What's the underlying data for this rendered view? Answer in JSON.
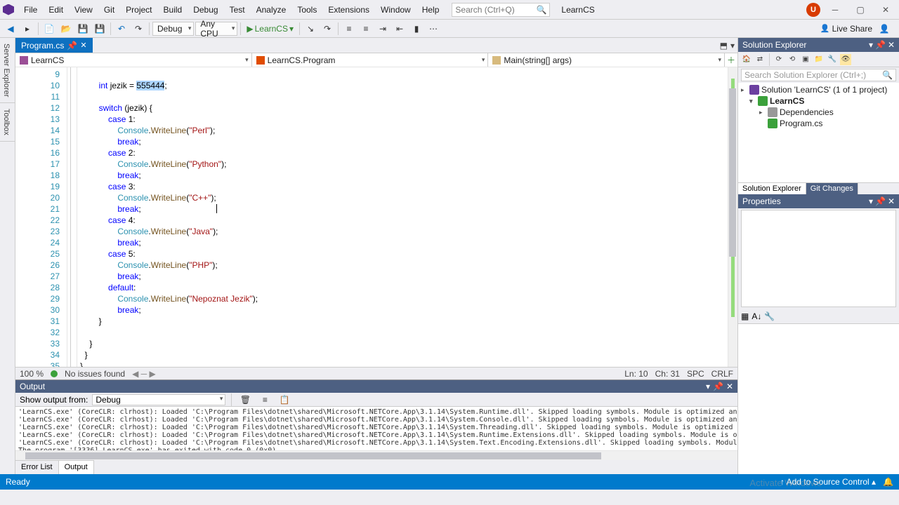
{
  "menubar": [
    "File",
    "Edit",
    "View",
    "Git",
    "Project",
    "Build",
    "Debug",
    "Test",
    "Analyze",
    "Tools",
    "Extensions",
    "Window",
    "Help"
  ],
  "search_placeholder": "Search (Ctrl+Q)",
  "title": "LearnCS",
  "user_initial": "U",
  "toolbar": {
    "config": "Debug",
    "platform": "Any CPU",
    "run_target": "LearnCS",
    "live_share": "Live Share"
  },
  "side_tabs": [
    "Server Explorer",
    "Toolbox"
  ],
  "doc_tab": "Program.cs",
  "nav": {
    "project": "LearnCS",
    "class": "LearnCS.Program",
    "member": "Main(string[] args)"
  },
  "code_lines": [
    {
      "n": 9,
      "indent": 8,
      "tokens": []
    },
    {
      "n": 10,
      "indent": 8,
      "tokens": [
        {
          "t": "int ",
          "c": "kw"
        },
        {
          "t": "jezik = "
        },
        {
          "t": "555444",
          "c": "num",
          "sel": true
        },
        {
          "t": ";"
        }
      ]
    },
    {
      "n": 11,
      "indent": 8,
      "tokens": []
    },
    {
      "n": 12,
      "indent": 8,
      "tokens": [
        {
          "t": "switch ",
          "c": "kw"
        },
        {
          "t": "(jezik) {"
        }
      ]
    },
    {
      "n": 13,
      "indent": 12,
      "tokens": [
        {
          "t": "case ",
          "c": "kw"
        },
        {
          "t": "1"
        },
        {
          "t": ":"
        }
      ]
    },
    {
      "n": 14,
      "indent": 16,
      "tokens": [
        {
          "t": "Console",
          "c": "cls"
        },
        {
          "t": "."
        },
        {
          "t": "WriteLine",
          "c": "mth"
        },
        {
          "t": "("
        },
        {
          "t": "\"Perl\"",
          "c": "str"
        },
        {
          "t": ");"
        }
      ]
    },
    {
      "n": 15,
      "indent": 16,
      "tokens": [
        {
          "t": "break",
          "c": "kw"
        },
        {
          "t": ";"
        }
      ]
    },
    {
      "n": 16,
      "indent": 12,
      "tokens": [
        {
          "t": "case ",
          "c": "kw"
        },
        {
          "t": "2"
        },
        {
          "t": ":"
        }
      ]
    },
    {
      "n": 17,
      "indent": 16,
      "tokens": [
        {
          "t": "Console",
          "c": "cls"
        },
        {
          "t": "."
        },
        {
          "t": "WriteLine",
          "c": "mth"
        },
        {
          "t": "("
        },
        {
          "t": "\"Python\"",
          "c": "str"
        },
        {
          "t": ");"
        }
      ]
    },
    {
      "n": 18,
      "indent": 16,
      "tokens": [
        {
          "t": "break",
          "c": "kw"
        },
        {
          "t": ";"
        }
      ]
    },
    {
      "n": 19,
      "indent": 12,
      "tokens": [
        {
          "t": "case ",
          "c": "kw"
        },
        {
          "t": "3"
        },
        {
          "t": ":"
        }
      ]
    },
    {
      "n": 20,
      "indent": 16,
      "tokens": [
        {
          "t": "Console",
          "c": "cls"
        },
        {
          "t": "."
        },
        {
          "t": "WriteLine",
          "c": "mth"
        },
        {
          "t": "("
        },
        {
          "t": "\"C++\"",
          "c": "str"
        },
        {
          "t": ");"
        }
      ]
    },
    {
      "n": 21,
      "indent": 16,
      "tokens": [
        {
          "t": "break",
          "c": "kw"
        },
        {
          "t": ";"
        }
      ]
    },
    {
      "n": 22,
      "indent": 12,
      "tokens": [
        {
          "t": "case ",
          "c": "kw"
        },
        {
          "t": "4"
        },
        {
          "t": ":"
        }
      ]
    },
    {
      "n": 23,
      "indent": 16,
      "tokens": [
        {
          "t": "Console",
          "c": "cls"
        },
        {
          "t": "."
        },
        {
          "t": "WriteLine",
          "c": "mth"
        },
        {
          "t": "("
        },
        {
          "t": "\"Java\"",
          "c": "str"
        },
        {
          "t": ");"
        }
      ]
    },
    {
      "n": 24,
      "indent": 16,
      "tokens": [
        {
          "t": "break",
          "c": "kw"
        },
        {
          "t": ";"
        }
      ]
    },
    {
      "n": 25,
      "indent": 12,
      "tokens": [
        {
          "t": "case ",
          "c": "kw"
        },
        {
          "t": "5"
        },
        {
          "t": ":"
        }
      ]
    },
    {
      "n": 26,
      "indent": 16,
      "tokens": [
        {
          "t": "Console",
          "c": "cls"
        },
        {
          "t": "."
        },
        {
          "t": "WriteLine",
          "c": "mth"
        },
        {
          "t": "("
        },
        {
          "t": "\"PHP\"",
          "c": "str"
        },
        {
          "t": ");"
        }
      ]
    },
    {
      "n": 27,
      "indent": 16,
      "tokens": [
        {
          "t": "break",
          "c": "kw"
        },
        {
          "t": ";"
        }
      ]
    },
    {
      "n": 28,
      "indent": 12,
      "tokens": [
        {
          "t": "default",
          "c": "kw"
        },
        {
          "t": ":"
        }
      ]
    },
    {
      "n": 29,
      "indent": 16,
      "tokens": [
        {
          "t": "Console",
          "c": "cls"
        },
        {
          "t": "."
        },
        {
          "t": "WriteLine",
          "c": "mth"
        },
        {
          "t": "("
        },
        {
          "t": "\"Nepoznat Jezik\"",
          "c": "str"
        },
        {
          "t": ");"
        }
      ]
    },
    {
      "n": 30,
      "indent": 16,
      "tokens": [
        {
          "t": "break",
          "c": "kw"
        },
        {
          "t": ";"
        }
      ]
    },
    {
      "n": 31,
      "indent": 8,
      "tokens": [
        {
          "t": "}"
        }
      ]
    },
    {
      "n": 32,
      "indent": 8,
      "tokens": []
    },
    {
      "n": 33,
      "indent": 4,
      "tokens": [
        {
          "t": "}"
        }
      ]
    },
    {
      "n": 34,
      "indent": 2,
      "tokens": [
        {
          "t": "}"
        }
      ]
    },
    {
      "n": 35,
      "indent": 0,
      "tokens": [
        {
          "t": "}"
        }
      ]
    }
  ],
  "editor_status": {
    "zoom": "100 %",
    "issues": "No issues found",
    "ln": "Ln: 10",
    "ch": "Ch: 31",
    "spc": "SPC",
    "eol": "CRLF"
  },
  "output": {
    "title": "Output",
    "show_from_label": "Show output from:",
    "show_from_value": "Debug",
    "lines": [
      "'LearnCS.exe' (CoreCLR: clrhost): Loaded 'C:\\Program Files\\dotnet\\shared\\Microsoft.NETCore.App\\3.1.14\\System.Runtime.dll'. Skipped loading symbols. Module is optimized and the debugger option 'Just My Code' is enab",
      "'LearnCS.exe' (CoreCLR: clrhost): Loaded 'C:\\Program Files\\dotnet\\shared\\Microsoft.NETCore.App\\3.1.14\\System.Console.dll'. Skipped loading symbols. Module is optimized and the debugger option 'Just My Code' is ena",
      "'LearnCS.exe' (CoreCLR: clrhost): Loaded 'C:\\Program Files\\dotnet\\shared\\Microsoft.NETCore.App\\3.1.14\\System.Threading.dll'. Skipped loading symbols. Module is optimized and the debugger option 'Just My Code' is en",
      "'LearnCS.exe' (CoreCLR: clrhost): Loaded 'C:\\Program Files\\dotnet\\shared\\Microsoft.NETCore.App\\3.1.14\\System.Runtime.Extensions.dll'. Skipped loading symbols. Module is optimized and the debugger option 'Just My Co",
      "'LearnCS.exe' (CoreCLR: clrhost): Loaded 'C:\\Program Files\\dotnet\\shared\\Microsoft.NETCore.App\\3.1.14\\System.Text.Encoding.Extensions.dll'. Skipped loading symbols. Module is optimized and the debugger option 'Just",
      "The program '[3336] LearnCS.exe' has exited with code 0 (0x0)."
    ]
  },
  "bottom_tabs": [
    "Error List",
    "Output"
  ],
  "solution_explorer": {
    "title": "Solution Explorer",
    "search_placeholder": "Search Solution Explorer (Ctrl+;)",
    "root": "Solution 'LearnCS' (1 of 1 project)",
    "project": "LearnCS",
    "dep": "Dependencies",
    "file": "Program.cs",
    "tabs": [
      "Solution Explorer",
      "Git Changes"
    ]
  },
  "properties": {
    "title": "Properties"
  },
  "status": {
    "ready": "Ready",
    "add_source": "Add to Source Control"
  },
  "watermark": "Activate Windows"
}
